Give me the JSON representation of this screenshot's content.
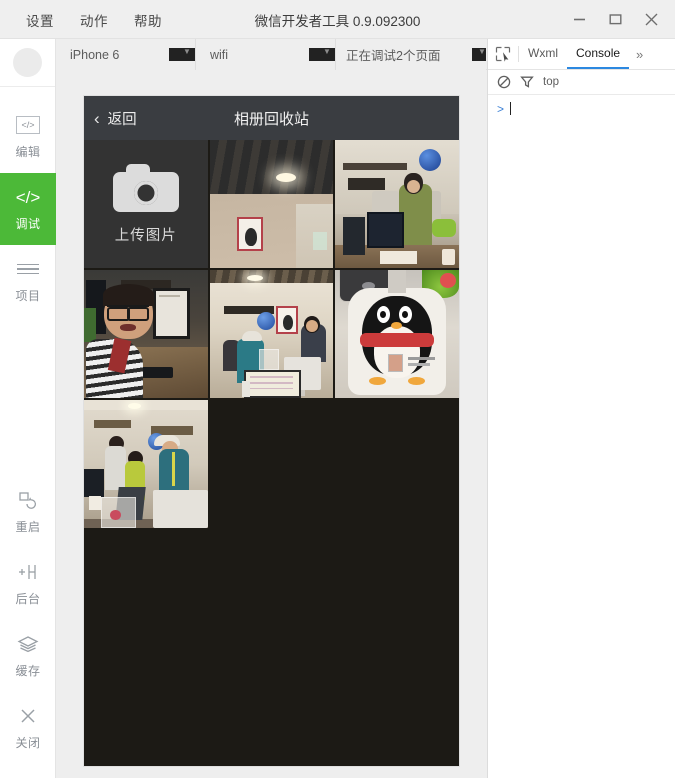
{
  "window": {
    "title": "微信开发者工具 0.9.092300",
    "controls": {
      "minimize": "minimize",
      "maximize": "maximize",
      "close": "close"
    }
  },
  "menubar": {
    "items": [
      {
        "label": "设置"
      },
      {
        "label": "动作"
      },
      {
        "label": "帮助"
      }
    ]
  },
  "sidebar": {
    "avatar": "avatar-placeholder",
    "items": [
      {
        "label": "编辑",
        "icon": "code-box-icon",
        "active": false
      },
      {
        "label": "调试",
        "icon": "code-icon",
        "active": true
      },
      {
        "label": "项目",
        "icon": "menu-icon",
        "active": false
      },
      {
        "label": "重启",
        "icon": "restart-icon",
        "active": false
      },
      {
        "label": "后台",
        "icon": "background-icon",
        "active": false
      },
      {
        "label": "缓存",
        "icon": "layers-icon",
        "active": false
      },
      {
        "label": "关闭",
        "icon": "close-icon",
        "active": false
      }
    ],
    "active_color": "#4cb938"
  },
  "toolbar": {
    "device": {
      "value": "iPhone 6",
      "caret": "▼"
    },
    "network": {
      "value": "wifi",
      "caret": "▼"
    },
    "pages": {
      "value": "正在调试2个页面",
      "caret": "▼"
    }
  },
  "simulator": {
    "navbar": {
      "back_label": "返回",
      "back_chevron": "‹",
      "title": "相册回收站"
    },
    "upload_tile": {
      "label": "上传图片",
      "icon": "camera-icon"
    },
    "photos": [
      {
        "name": "photo-ceiling-poster",
        "alt": "办公室天花板与相框"
      },
      {
        "name": "photo-person-on-phone",
        "alt": "办公桌前打电话的人"
      },
      {
        "name": "photo-man-striped-shirt",
        "alt": "戴眼镜穿条纹衣的男子"
      },
      {
        "name": "photo-office-group",
        "alt": "办公室里的几个人"
      },
      {
        "name": "photo-qq-penguin",
        "alt": "QQ企鹅工牌挂绳"
      },
      {
        "name": "photo-three-people-office",
        "alt": "办公室里三个人"
      }
    ],
    "bg_color": "#1c1a15",
    "navbar_color": "#3a3d41"
  },
  "devtools": {
    "inspect_icon": "inspect-cursor-icon",
    "tabs": [
      {
        "label": "Wxml",
        "active": false
      },
      {
        "label": "Console",
        "active": true
      }
    ],
    "more": "»",
    "subbar": {
      "clear_icon": "clear-console-icon",
      "filter_icon": "filter-icon",
      "scope": "top"
    },
    "console": {
      "prompt": ">",
      "input_value": "",
      "placeholder": ""
    },
    "active_tab_underline": "#2c88e0"
  }
}
